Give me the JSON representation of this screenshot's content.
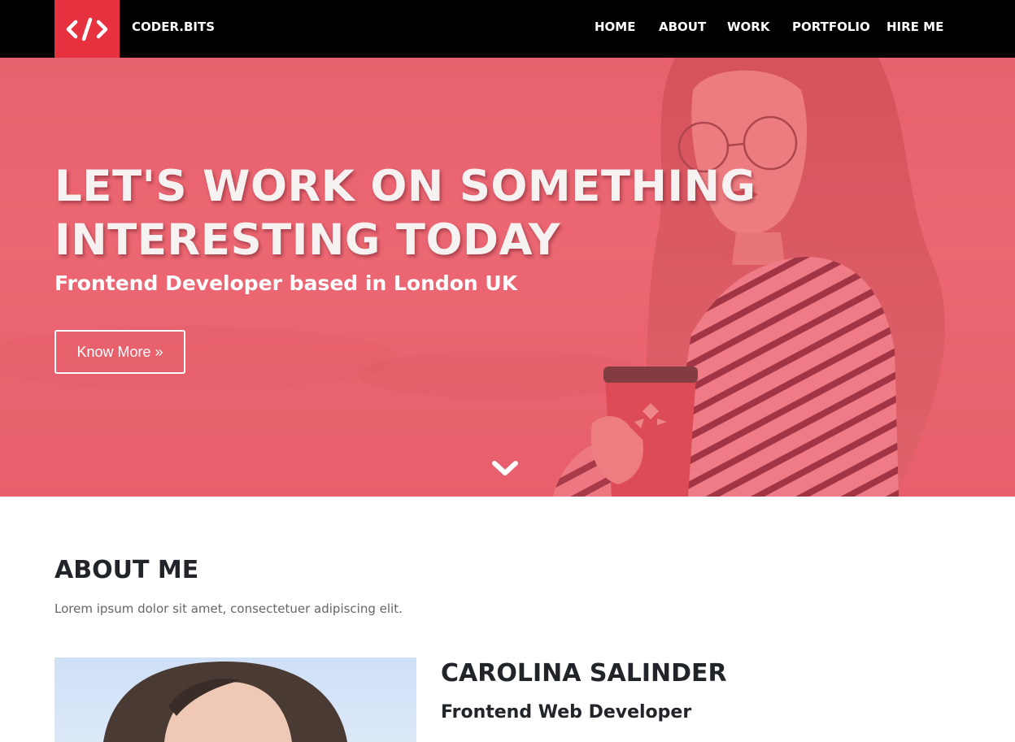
{
  "brand": {
    "name": "CODER.BITS",
    "logo_icon": "code-brackets-icon",
    "logo_color": "#e8313f"
  },
  "nav": {
    "items": [
      {
        "label": "HOME"
      },
      {
        "label": "ABOUT"
      },
      {
        "label": "WORK"
      },
      {
        "label": "PORTFOLIO"
      },
      {
        "label": "HIRE ME"
      }
    ]
  },
  "hero": {
    "title_line1": "LET'S WORK ON SOMETHING",
    "title_line2": "INTERESTING TODAY",
    "subtitle": "Frontend Developer based in London UK",
    "button_label": "Know More »",
    "scroll_icon": "chevron-down-icon",
    "overlay_color": "#e8606c"
  },
  "about": {
    "heading": "ABOUT ME",
    "intro": "Lorem ipsum dolor sit amet, consectetuer adipiscing elit.",
    "name": "CAROLINA SALINDER",
    "role": "Frontend Web Developer"
  },
  "colors": {
    "navbar_bg": "#000000",
    "accent": "#e8313f",
    "text_dark": "#212529",
    "text_muted": "#666666"
  }
}
